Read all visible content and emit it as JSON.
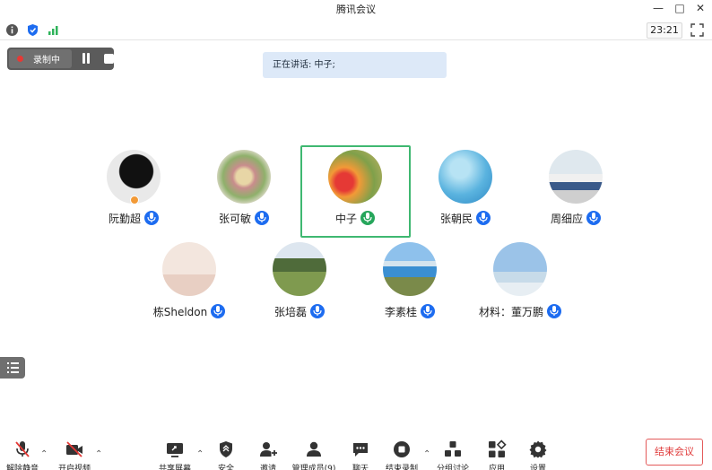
{
  "window": {
    "title": "腾讯会议"
  },
  "status_bar": {
    "timer": "23:21"
  },
  "recording": {
    "label": "录制中"
  },
  "speaking": {
    "text": "正在讲话: 中子;"
  },
  "participants": [
    {
      "name": "阮勤超",
      "mic_color": "#1d6cf0"
    },
    {
      "name": "张可敏",
      "mic_color": "#1d6cf0"
    },
    {
      "name": "中子",
      "mic_color": "#26a65b"
    },
    {
      "name": "张朝民",
      "mic_color": "#1d6cf0"
    },
    {
      "name": "周细应",
      "mic_color": "#1d6cf0"
    },
    {
      "name": "栋Sheldon",
      "mic_color": "#1d6cf0"
    },
    {
      "name": "张培磊",
      "mic_color": "#1d6cf0"
    },
    {
      "name": "李素桂",
      "mic_color": "#1d6cf0"
    },
    {
      "name": "材料：董万鹏",
      "mic_color": "#1d6cf0"
    }
  ],
  "toolbar": {
    "unmute": "解除静音",
    "start_video": "开启视频",
    "share_screen": "共享屏幕",
    "security": "安全",
    "invite": "邀请",
    "manage_members": "管理成员(9)",
    "chat": "聊天",
    "end_recording": "结束录制",
    "breakout": "分组讨论",
    "apps": "应用",
    "settings": "设置",
    "end_meeting": "结束会议"
  },
  "colors": {
    "accent": "#1d6cf0",
    "speaking_green": "#3fb871",
    "end_red": "#e03c3c"
  }
}
